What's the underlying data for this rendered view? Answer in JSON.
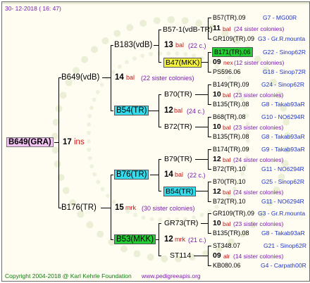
{
  "header": {
    "date": "30-  12-2018  ( 16:  47)"
  },
  "footer": {
    "copyright": "Copyright 2004-2018 @ Karl Kehrle Foundation",
    "site": "www.pedigreeapis.org"
  },
  "root": {
    "name": "B649(GRA)",
    "num": "17",
    "unit": "ins"
  },
  "gen1": [
    {
      "name": "B649(vdB)"
    },
    {
      "name": "B176(TR)",
      "num": "15",
      "unit": "mrk",
      "note": "(30 sister colonies)"
    }
  ],
  "gen1_info": {
    "num": "14",
    "unit": "bal",
    "note": "(22 sister colonies)"
  },
  "gen2": [
    {
      "name": "B183(vdB)",
      "num": "13",
      "unit": "bal",
      "note": "(22 c.)"
    },
    {
      "name": "B54(TR)",
      "num": "12",
      "unit": "bal",
      "note": "(24 c.)"
    },
    {
      "name": "B76(TR)",
      "num": "14",
      "unit": "bal",
      "note": "(22 c.)"
    },
    {
      "name": "B53(MKK)",
      "num": "12",
      "unit": "mrk",
      "note": "(21 c.)"
    }
  ],
  "gen3": [
    {
      "name": "B57-1(vdB-TR)",
      "num": "11",
      "unit": "bal",
      "note": "(24 sister colonies)"
    },
    {
      "name": "B47(MKK)",
      "num": "09",
      "unit": "nex",
      "note": "(12 sister colonies)"
    },
    {
      "name": "B70(TR)",
      "num": "10",
      "unit": "bal",
      "note": "(23 sister colonies)"
    },
    {
      "name": "B72(TR)",
      "num": "10",
      "unit": "bal",
      "note": "(23 sister colonies)"
    },
    {
      "name": "B79(TR)",
      "num": "12",
      "unit": "bal",
      "note": "(24 sister colonies)"
    },
    {
      "name": "B54(TR)",
      "num": "12",
      "unit": "bal",
      "note": "(24 sister colonies)"
    },
    {
      "name": "GR73(TR)",
      "num": "10",
      "unit": "bal",
      "note": "(23 sister colonies)"
    },
    {
      "name": "ST114",
      "num": "09",
      "unit": "alr",
      "note": "(14 sister colonies)"
    }
  ],
  "gen4": [
    {
      "name": "B57(TR).09",
      "code": "G7 - MG00R"
    },
    {
      "name": "GR109(TR).09",
      "code": "G3 - Gr.R.mounta"
    },
    {
      "name": "B171(TR).06",
      "code": "G22 - Sinop62R"
    },
    {
      "name": "PS596.06",
      "code": "G18 - Sinop72R"
    },
    {
      "name": "B149(TR).09",
      "code": "G24 - Sinop62R"
    },
    {
      "name": "B135(TR).08",
      "code": "G8 - Takab93aR"
    },
    {
      "name": "B68(TR).08",
      "code": "G10 - NO6294R"
    },
    {
      "name": "B135(TR).08",
      "code": "G8 - Takab93aR"
    },
    {
      "name": "B174(TR).09",
      "code": "G9 - Takab93aR"
    },
    {
      "name": "B72(TR).10",
      "code": "G11 - NO6294R"
    },
    {
      "name": "B70(TR).10",
      "code": "G25 - Sinop62R"
    },
    {
      "name": "B72(TR).10",
      "code": "G11 - NO6294R"
    },
    {
      "name": "GR109(TR).09",
      "code": "G3 - Gr.R.mounta"
    },
    {
      "name": "B135(TR).08",
      "code": "G8 - Takab93aR"
    },
    {
      "name": "ST348.07",
      "code": "G21 - Sinop62R"
    },
    {
      "name": "KB080.06",
      "code": "G4 - Carpath00R"
    }
  ],
  "colors": {
    "cyan": "#33ddee",
    "yellow": "#f5f23a",
    "green": "#22cc33",
    "pink": "#f3c3f3",
    "red": "#c81414",
    "blue": "#1f35c8",
    "purple": "#7a1bb0"
  }
}
